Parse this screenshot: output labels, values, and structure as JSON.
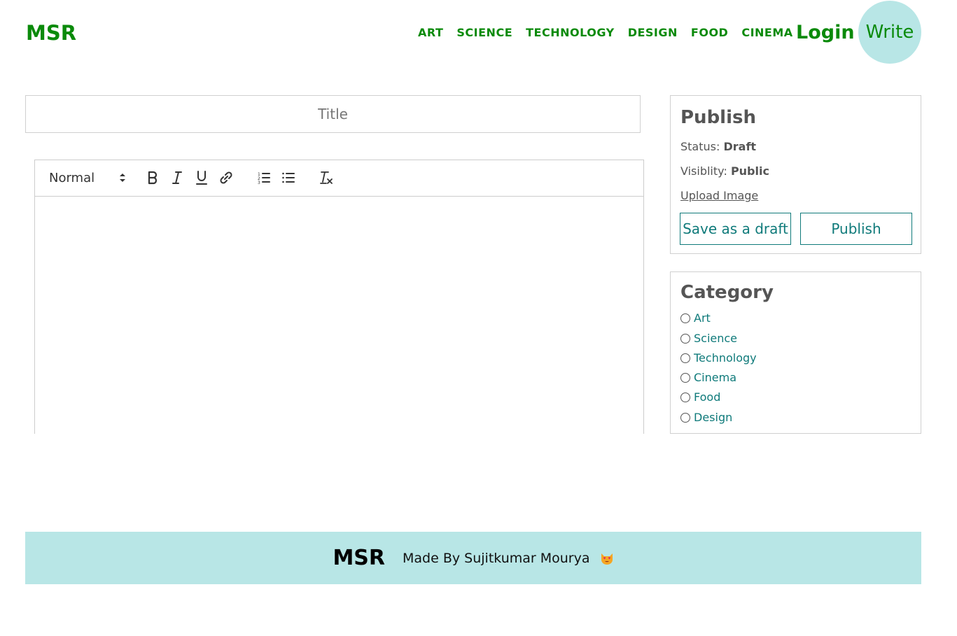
{
  "header": {
    "logo": "MSR",
    "nav": [
      "ART",
      "SCIENCE",
      "TECHNOLOGY",
      "DESIGN",
      "FOOD",
      "CINEMA"
    ],
    "login_label": "Login",
    "write_label": "Write"
  },
  "editor": {
    "title_placeholder": "Title",
    "format_select": "Normal",
    "toolbar_icons": [
      "bold-icon",
      "italic-icon",
      "underline-icon",
      "link-icon",
      "ordered-list-icon",
      "bullet-list-icon",
      "clear-format-icon"
    ]
  },
  "publish": {
    "heading": "Publish",
    "status_label": "Status:",
    "status_value": "Draft",
    "visibility_label": "Visiblity:",
    "visibility_value": "Public",
    "upload_label": "Upload Image",
    "save_draft_label": "Save as a draft",
    "publish_label": "Publish"
  },
  "category": {
    "heading": "Category",
    "options": [
      "Art",
      "Science",
      "Technology",
      "Cinema",
      "Food",
      "Design"
    ]
  },
  "footer": {
    "logo": "MSR",
    "credit": "Made By Sujitkumar Mourya"
  },
  "colors": {
    "brand_green": "#0a8a0a",
    "accent_teal": "#0f7a7a",
    "light_cyan": "#b8e6e6"
  }
}
